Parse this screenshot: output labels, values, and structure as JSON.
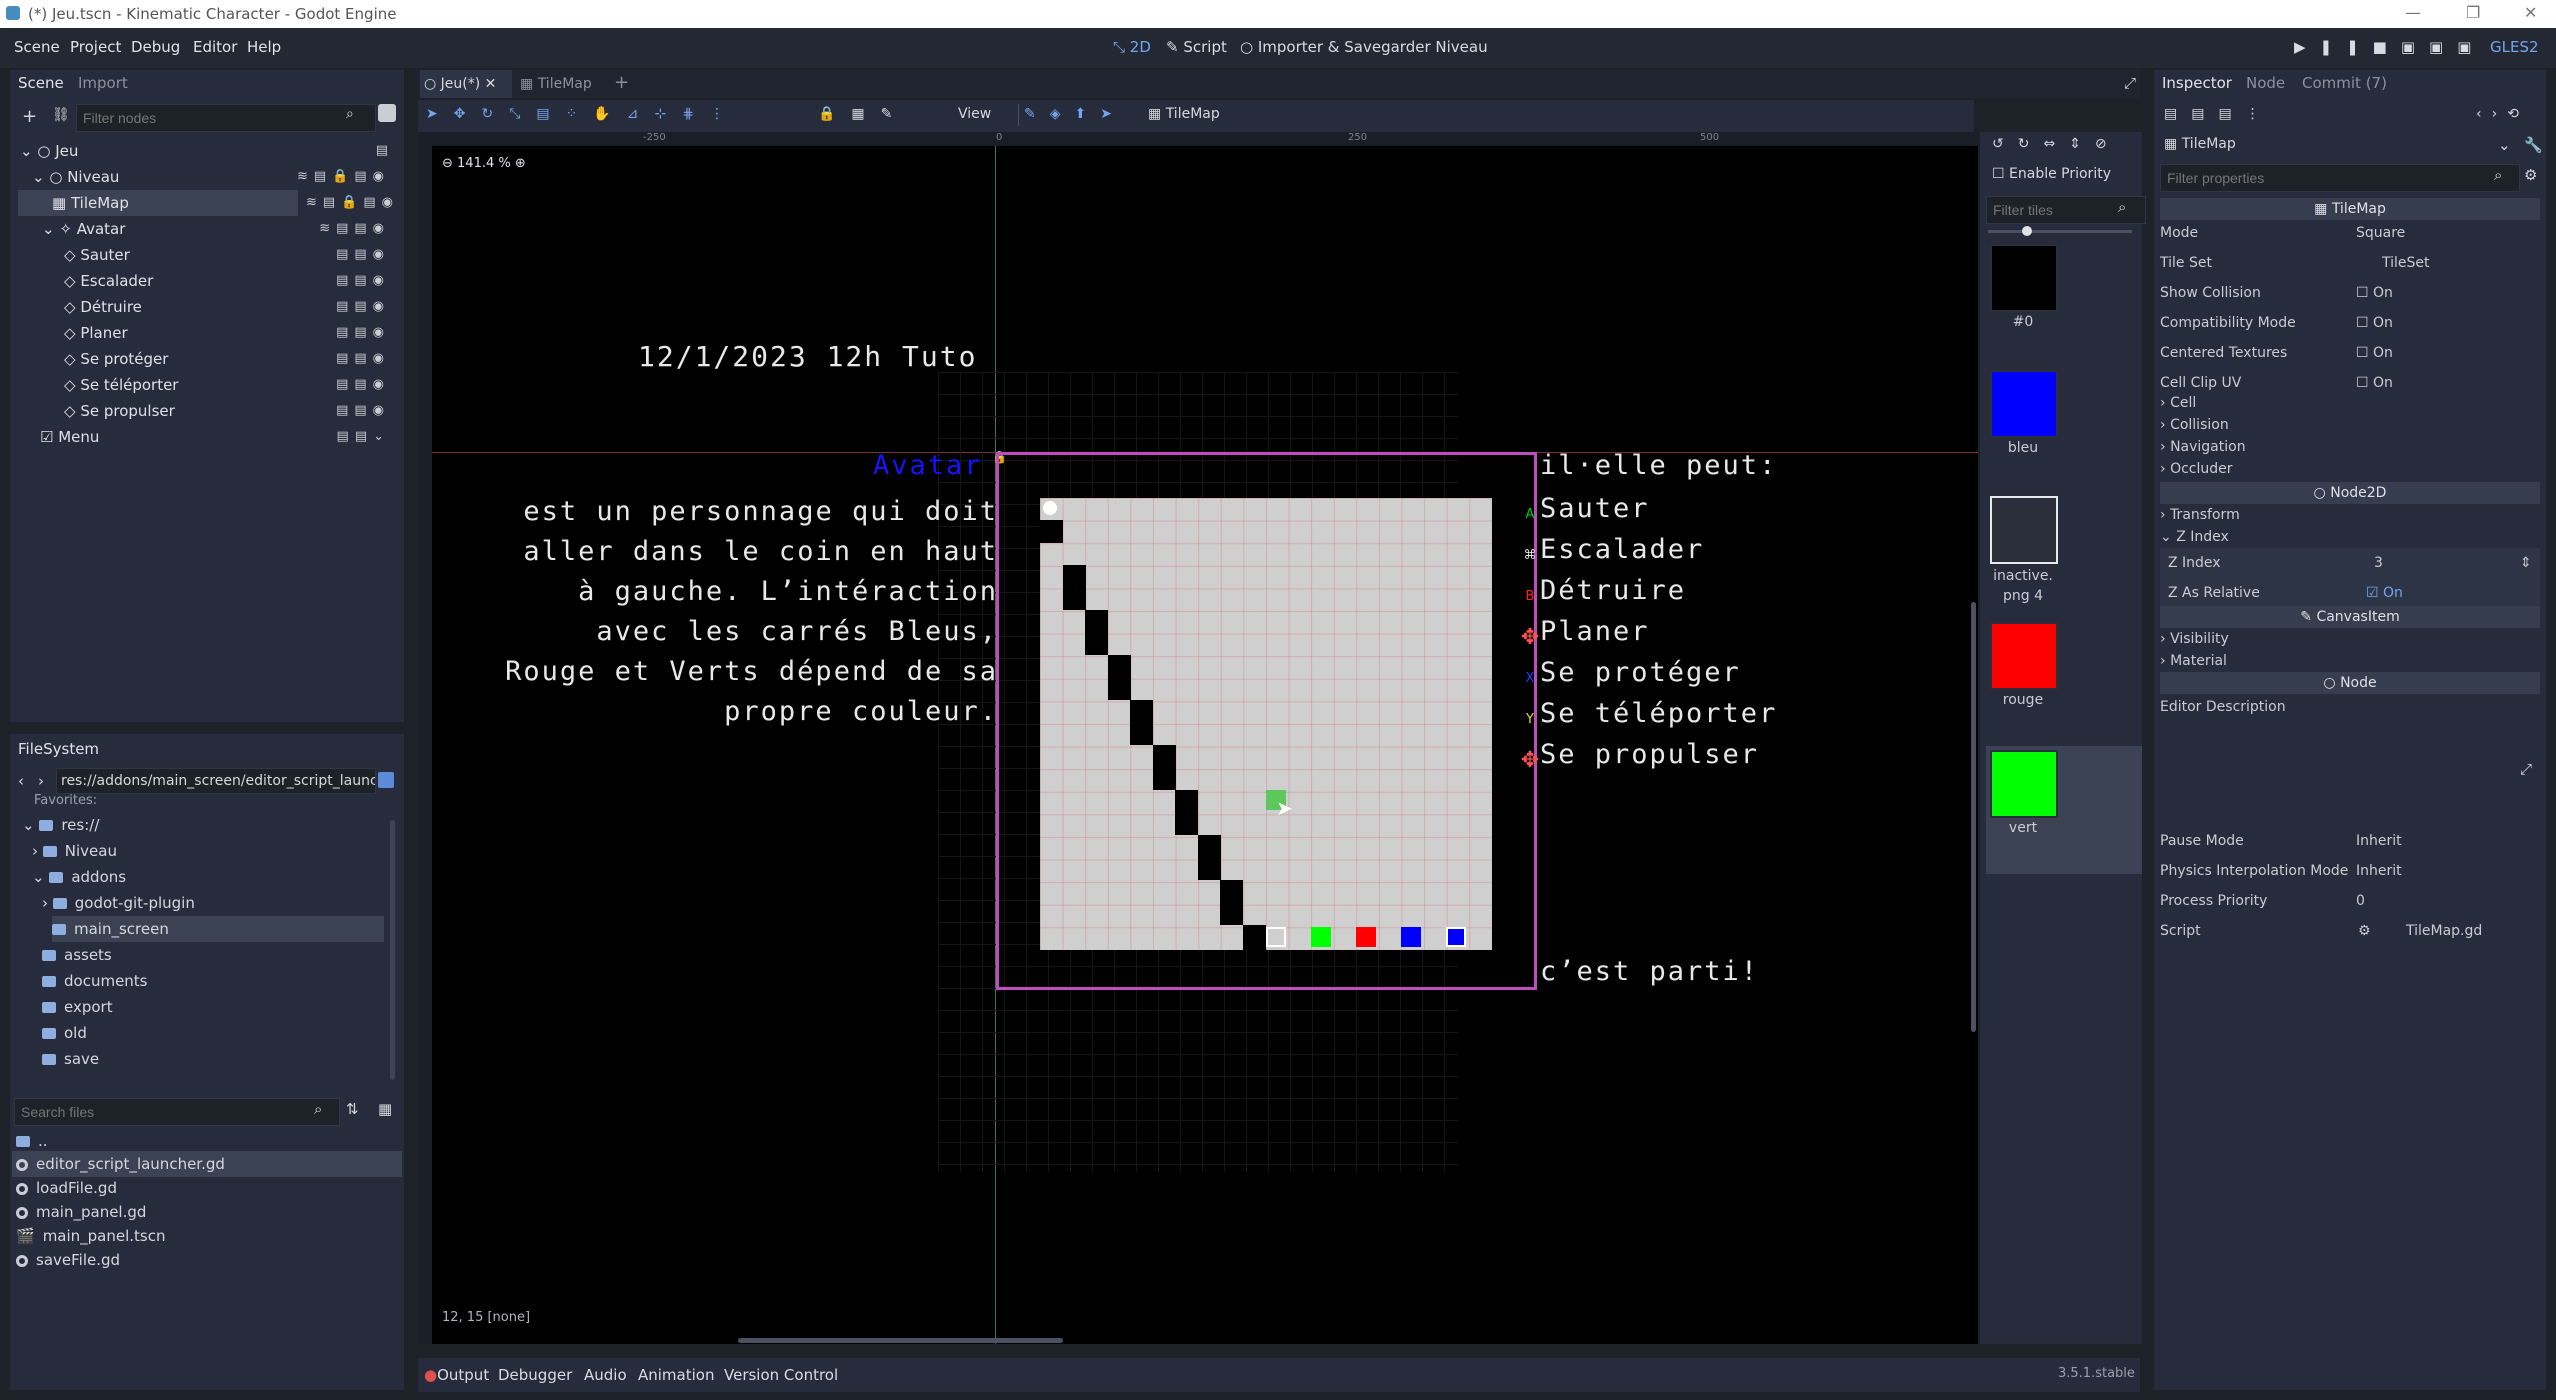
{
  "window": {
    "title": "(*) Jeu.tscn - Kinematic Character - Godot Engine",
    "controls": [
      "—",
      "❐",
      "✕"
    ]
  },
  "menubar": {
    "items": [
      "Scene",
      "Project",
      "Debug",
      "Editor",
      "Help"
    ],
    "modes": [
      "2D",
      "Script",
      "Importer & Savegarder Niveau"
    ],
    "renderer": "GLES2"
  },
  "scene_dock": {
    "tabs": [
      "Scene",
      "Import"
    ],
    "filter_placeholder": "Filter nodes",
    "nodes": [
      {
        "label": "Jeu"
      },
      {
        "label": "Niveau"
      },
      {
        "label": "TileMap"
      },
      {
        "label": "Avatar"
      },
      {
        "label": "Sauter"
      },
      {
        "label": "Escalader"
      },
      {
        "label": "Détruire"
      },
      {
        "label": "Planer"
      },
      {
        "label": "Se protéger"
      },
      {
        "label": "Se téléporter"
      },
      {
        "label": "Se propulser"
      },
      {
        "label": "Menu"
      }
    ]
  },
  "filesystem": {
    "title": "FileSystem",
    "path": "res://addons/main_screen/editor_script_launc",
    "favorites": "Favorites:",
    "tree": [
      "res://",
      "Niveau",
      "addons",
      "godot-git-plugin",
      "main_screen",
      "assets",
      "documents",
      "export",
      "old",
      "save"
    ],
    "search_placeholder": "Search files",
    "files": [
      "..",
      "editor_script_launcher.gd",
      "loadFile.gd",
      "main_panel.gd",
      "main_panel.tscn",
      "saveFile.gd"
    ]
  },
  "editor": {
    "tabs": [
      "Jeu(*)",
      "TileMap"
    ],
    "toolbar_view": "View",
    "toolbar_tilemap": "TileMap",
    "zoom": "141.4 %",
    "ruler": [
      "-250",
      "0",
      "250",
      "500"
    ],
    "status": "12, 15 [none]",
    "canvas": {
      "date_text": "12/1/2023 12h Tuto",
      "avatar_title": "Avatar",
      "description": [
        "est un personnage qui doit",
        "aller dans le coin en haut",
        "à gauche. L’intéraction",
        "avec les carrés Bleus,",
        "Rouge et Verts dépend de sa",
        "propre couleur."
      ],
      "abilities_title": "il·elle peut:",
      "abilities": [
        "Sauter",
        "Escalader",
        "Détruire",
        "Planer",
        "Se protéger",
        "Se téléporter",
        "Se propulser"
      ],
      "ability_keys": [
        "A",
        "⌘",
        "B",
        "✥",
        "X",
        "Y",
        "✥"
      ],
      "ending": "c’est parti!",
      "colors": {
        "blue": "#0000ff",
        "red": "#ff0000",
        "green": "#00ff00",
        "frame": "#c04cc0"
      }
    }
  },
  "tile_panel": {
    "enable_priority": "Enable Priority",
    "filter_placeholder": "Filter tiles",
    "tiles": [
      {
        "name": "#0",
        "color": "#000000"
      },
      {
        "name": "bleu",
        "color": "#0000ff"
      },
      {
        "name": "inactive.\npng 4",
        "color": "#2b2f3b"
      },
      {
        "name": "rouge",
        "color": "#ff0000"
      },
      {
        "name": "vert",
        "color": "#00ff00"
      }
    ]
  },
  "inspector": {
    "tabs": [
      "Inspector",
      "Node",
      "Commit (7)"
    ],
    "object": "TileMap",
    "filter_placeholder": "Filter properties",
    "class_header": "TileMap",
    "props": [
      {
        "label": "Mode",
        "value": "Square"
      },
      {
        "label": "Tile Set",
        "value": "TileSet"
      },
      {
        "label": "Show Collision",
        "value": "On"
      },
      {
        "label": "Compatibility Mode",
        "value": "On"
      },
      {
        "label": "Centered Textures",
        "value": "On"
      },
      {
        "label": "Cell Clip UV",
        "value": "On"
      }
    ],
    "groups": [
      "Cell",
      "Collision",
      "Navigation",
      "Occluder"
    ],
    "node2d_header": "Node2D",
    "node2d_groups": [
      "Transform",
      "Z Index"
    ],
    "z_index_label": "Z Index",
    "z_index_value": "3",
    "z_relative_label": "Z As Relative",
    "z_relative_value": "On",
    "canvasitem_header": "CanvasItem",
    "canvasitem_groups": [
      "Visibility",
      "Material"
    ],
    "node_header": "Node",
    "editor_description": "Editor Description",
    "node_props": [
      {
        "label": "Pause Mode",
        "value": "Inherit"
      },
      {
        "label": "Physics Interpolation Mode",
        "value": "Inherit"
      },
      {
        "label": "Process Priority",
        "value": "0"
      },
      {
        "label": "Script",
        "value": "TileMap.gd"
      }
    ]
  },
  "bottom": {
    "tabs": [
      "Output",
      "Debugger",
      "Audio",
      "Animation",
      "Version Control"
    ],
    "version": "3.5.1.stable"
  }
}
